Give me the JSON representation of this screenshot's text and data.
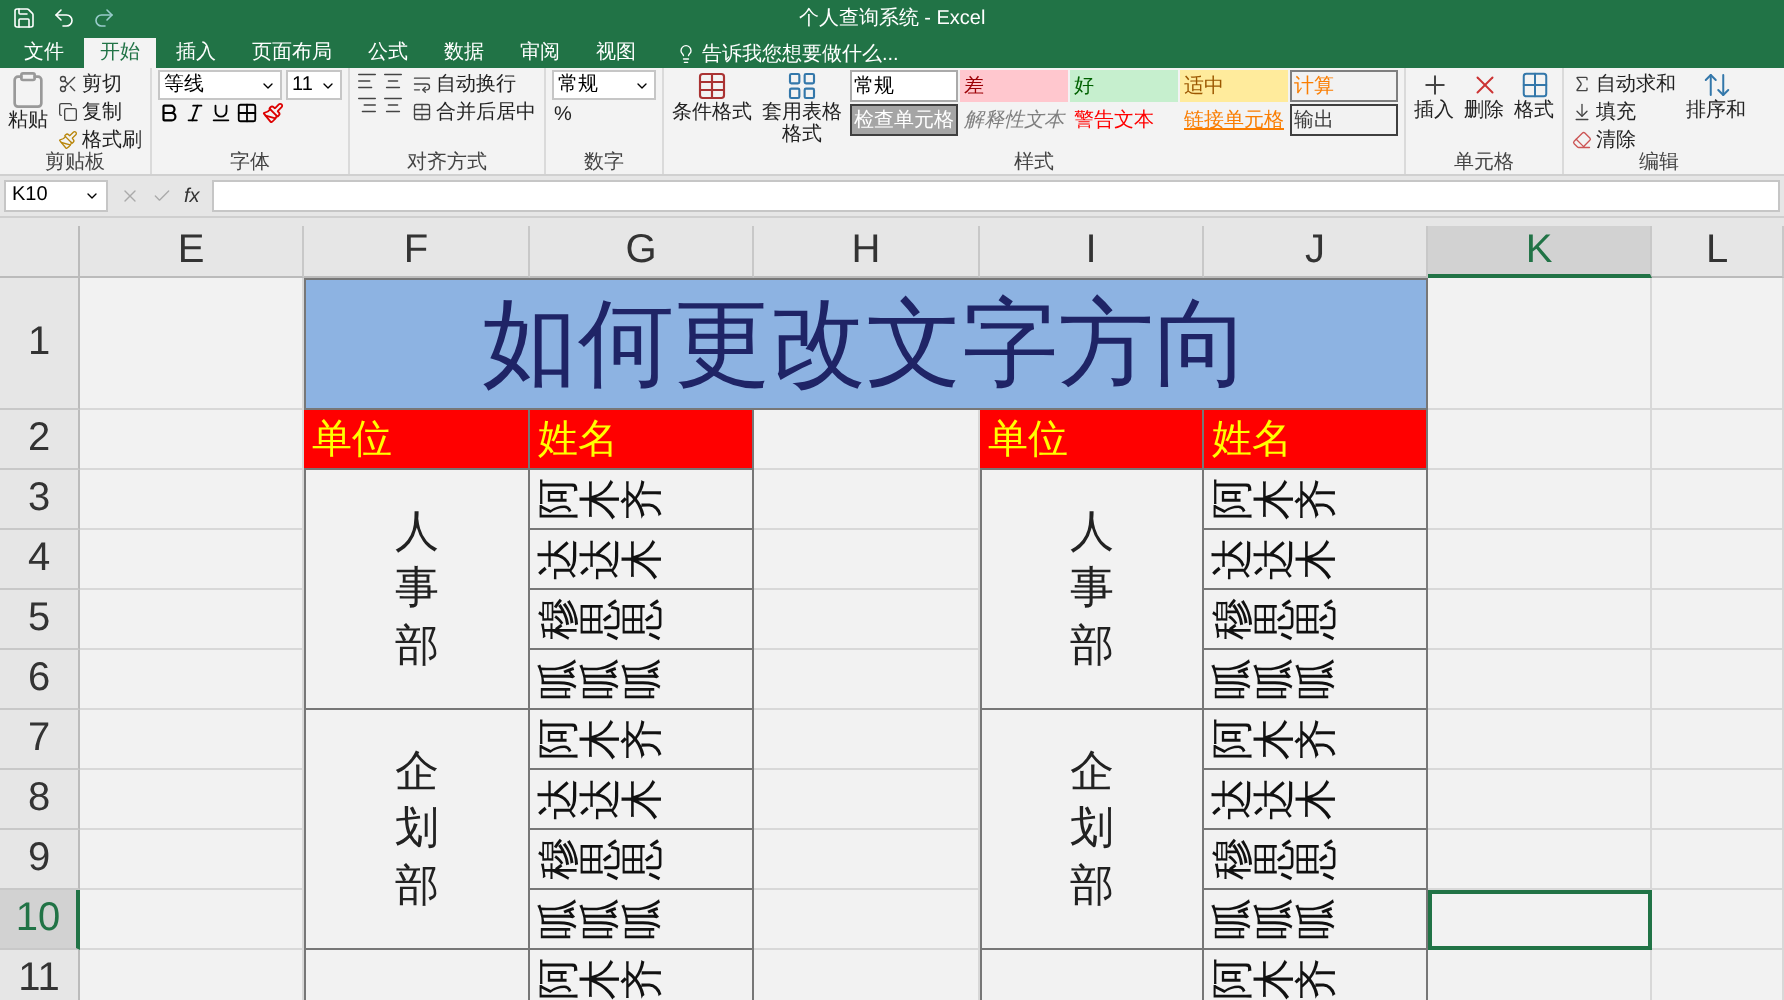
{
  "title_bar": {
    "title": "个人查询系统 - Excel"
  },
  "tabs": [
    {
      "label": "文件",
      "selected": false
    },
    {
      "label": "开始",
      "selected": true
    },
    {
      "label": "插入",
      "selected": false
    },
    {
      "label": "页面布局",
      "selected": false
    },
    {
      "label": "公式",
      "selected": false
    },
    {
      "label": "数据",
      "selected": false
    },
    {
      "label": "审阅",
      "selected": false
    },
    {
      "label": "视图",
      "selected": false
    }
  ],
  "tell_me": {
    "placeholder": "告诉我您想要做什么..."
  },
  "ribbon": {
    "clipboard": {
      "label": "剪贴板",
      "paste": "粘贴",
      "cut": "剪切",
      "copy": "复制",
      "format_painter": "格式刷"
    },
    "font": {
      "label": "字体",
      "name": "等线",
      "size": "11"
    },
    "alignment": {
      "label": "对齐方式",
      "wrap": "自动换行",
      "merge": "合并后居中"
    },
    "number": {
      "label": "数字",
      "format": "常规",
      "percent": "%"
    },
    "styles": {
      "label": "样式",
      "conditional": "条件格式",
      "table_format": "套用表格格式",
      "cells": [
        {
          "label": "常规",
          "kind": "normal"
        },
        {
          "label": "差",
          "kind": "bad"
        },
        {
          "label": "好",
          "kind": "good"
        },
        {
          "label": "适中",
          "kind": "neutral"
        },
        {
          "label": "计算",
          "kind": "calculation"
        },
        {
          "label": "检查单元格",
          "kind": "check"
        },
        {
          "label": "解释性文本",
          "kind": "explanatory"
        },
        {
          "label": "警告文本",
          "kind": "warning"
        },
        {
          "label": "链接单元格",
          "kind": "linked"
        },
        {
          "label": "输出",
          "kind": "output"
        }
      ]
    },
    "cells": {
      "label": "单元格",
      "insert": "插入",
      "delete": "删除",
      "format": "格式"
    },
    "editing": {
      "label": "编辑",
      "autosum": "自动求和",
      "fill": "填充",
      "clear": "清除",
      "sort": "排序和"
    }
  },
  "formula_bar": {
    "name_box": "K10",
    "fx": "fx"
  },
  "sheet": {
    "columns": [
      {
        "label": "E",
        "selected": false
      },
      {
        "label": "F",
        "selected": false
      },
      {
        "label": "G",
        "selected": false
      },
      {
        "label": "H",
        "selected": false
      },
      {
        "label": "I",
        "selected": false
      },
      {
        "label": "J",
        "selected": false
      },
      {
        "label": "K",
        "selected": true
      },
      {
        "label": "L",
        "selected": false
      }
    ],
    "rows": [
      {
        "label": "1",
        "selected": false
      },
      {
        "label": "2",
        "selected": false
      },
      {
        "label": "3",
        "selected": false
      },
      {
        "label": "4",
        "selected": false
      },
      {
        "label": "5",
        "selected": false
      },
      {
        "label": "6",
        "selected": false
      },
      {
        "label": "7",
        "selected": false
      },
      {
        "label": "8",
        "selected": false
      },
      {
        "label": "9",
        "selected": false
      },
      {
        "label": "10",
        "selected": true
      },
      {
        "label": "11",
        "selected": false
      }
    ],
    "title": "如何更改文字方向",
    "tables": [
      {
        "headers": [
          "单位",
          "姓名"
        ],
        "groups": [
          {
            "department": "人事部",
            "names": [
              "阿木齐",
              "达达木",
              "穆思思",
              "呱呱呱"
            ]
          },
          {
            "department": "企划部",
            "names": [
              "阿木齐",
              "达达木",
              "穆思思",
              "呱呱呱"
            ]
          },
          {
            "names": [
              "阿木齐"
            ]
          }
        ]
      },
      {
        "headers": [
          "单位",
          "姓名"
        ],
        "groups": [
          {
            "department": "人事部",
            "names": [
              "阿木齐",
              "达达木",
              "穆思思",
              "呱呱呱"
            ]
          },
          {
            "department": "企划部",
            "names": [
              "阿木齐",
              "达达木",
              "穆思思",
              "呱呱呱"
            ]
          },
          {
            "names": [
              "阿木齐"
            ]
          }
        ]
      }
    ]
  }
}
